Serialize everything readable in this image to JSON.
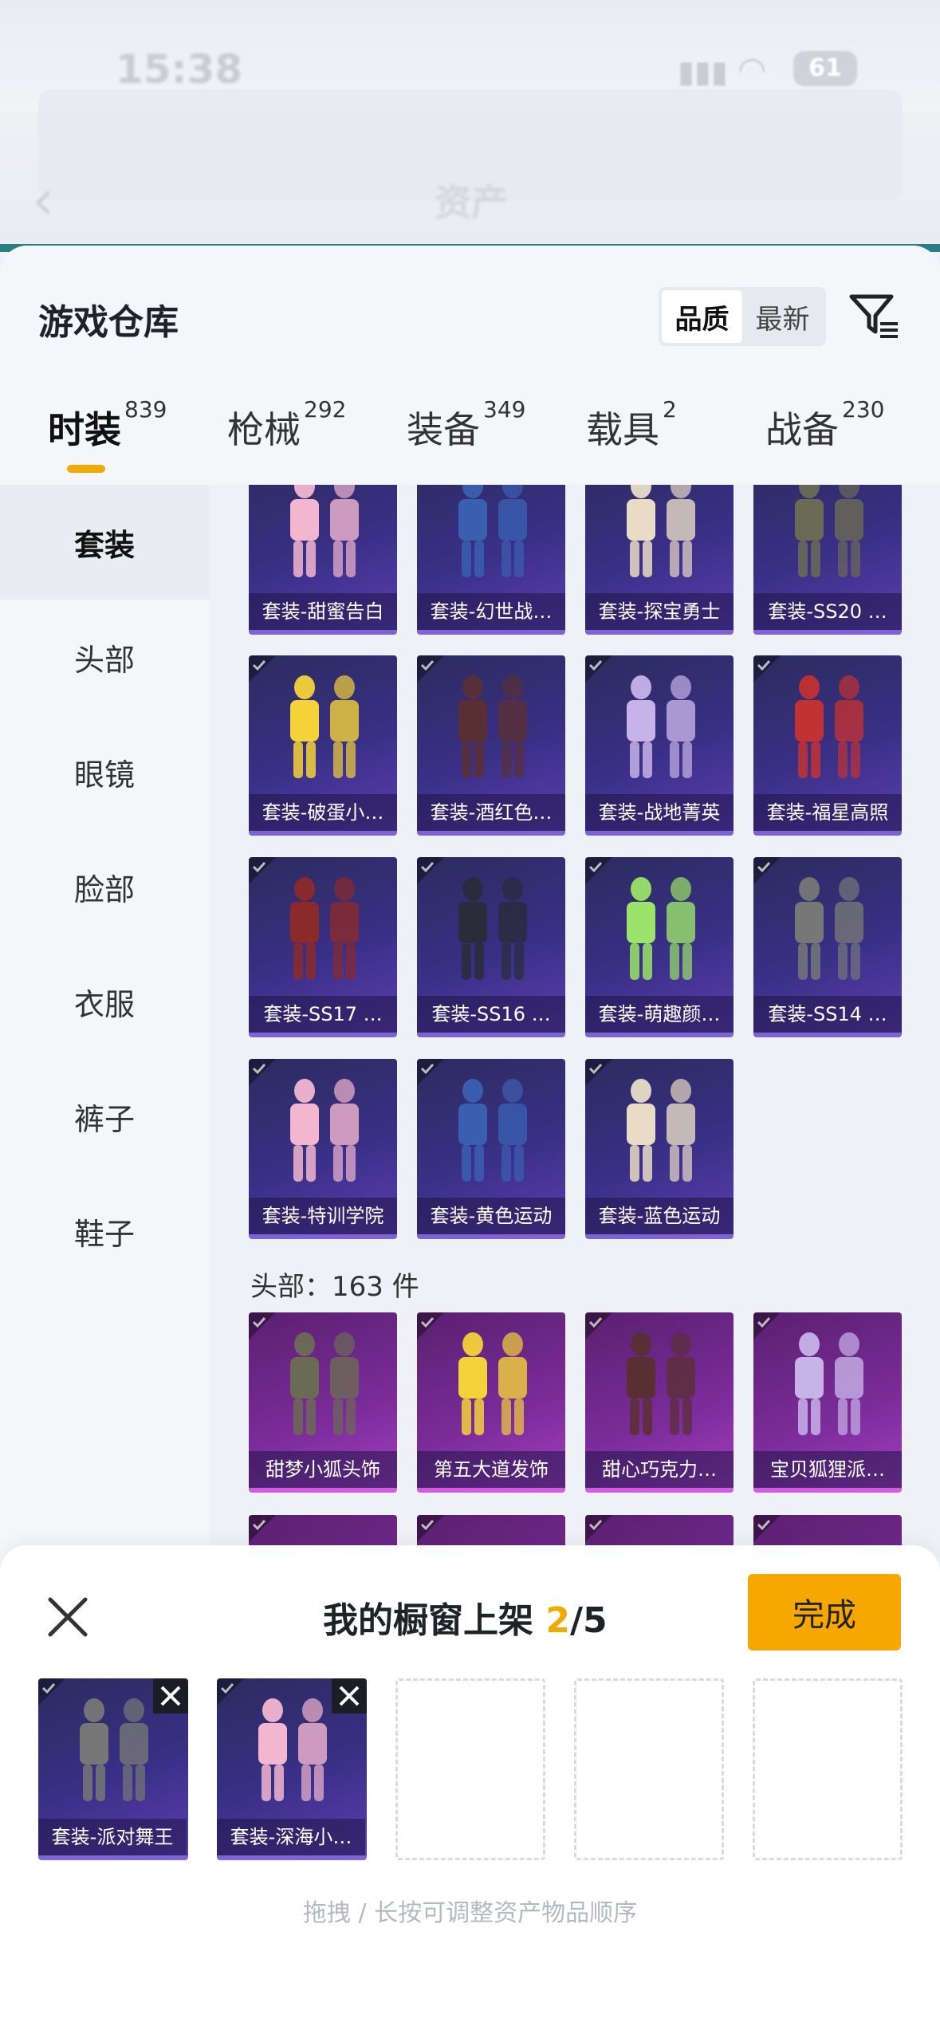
{
  "status": {
    "time": "15:38",
    "battery": "61"
  },
  "nav": {
    "title": "资产"
  },
  "sheet": {
    "title": "游戏仓库",
    "sort": [
      "品质",
      "最新"
    ],
    "tabs": [
      {
        "label": "时装",
        "count": "839"
      },
      {
        "label": "枪械",
        "count": "292"
      },
      {
        "label": "装备",
        "count": "349"
      },
      {
        "label": "载具",
        "count": "2"
      },
      {
        "label": "战备",
        "count": "230"
      }
    ],
    "categories": [
      "套装",
      "头部",
      "眼镜",
      "脸部",
      "衣服",
      "裤子",
      "鞋子"
    ],
    "suits": [
      "套装-甜蜜告白",
      "套装-幻世战…",
      "套装-探宝勇士",
      "套装-SS20 …",
      "套装-破蛋小…",
      "套装-酒红色…",
      "套装-战地菁英",
      "套装-福星高照",
      "套装-SS17 …",
      "套装-SS16 …",
      "套装-萌趣颜…",
      "套装-SS14 …",
      "套装-特训学院",
      "套装-黄色运动",
      "套装-蓝色运动"
    ],
    "head_section_label": "头部：163 件",
    "heads": [
      "甜梦小狐头饰",
      "第五大道发饰",
      "甜心巧克力…",
      "宝贝狐狸派…"
    ]
  },
  "panel": {
    "title_prefix": "我的橱窗上架 ",
    "count_current": "2",
    "count_total": "/5",
    "done_label": "完成",
    "slots": [
      "套装-派对舞王",
      "套装-深海小…"
    ],
    "hint": "拖拽 / 长按可调整资产物品顺序"
  },
  "colors": {
    "accent": "#f7a800",
    "card_purple": "#3a2f86",
    "card_pink": "#7b2c9a"
  }
}
